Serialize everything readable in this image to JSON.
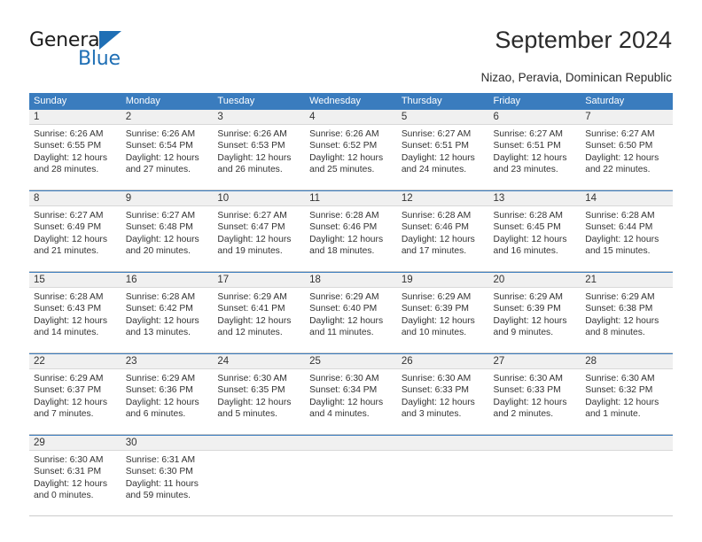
{
  "brand": {
    "name_part1": "General",
    "name_part2": "Blue",
    "triangle_icon": "triangle-logo-icon",
    "accent_color": "#1f6fb5"
  },
  "header": {
    "title": "September 2024",
    "subtitle": "Nizao, Peravia, Dominican Republic"
  },
  "calendar": {
    "header_bg": "#3a7cbe",
    "daynum_bg": "#f0f0f0",
    "weekday_headers": [
      "Sunday",
      "Monday",
      "Tuesday",
      "Wednesday",
      "Thursday",
      "Friday",
      "Saturday"
    ],
    "weeks": [
      [
        {
          "day": "1",
          "l1": "Sunrise: 6:26 AM",
          "l2": "Sunset: 6:55 PM",
          "l3": "Daylight: 12 hours",
          "l4": "and 28 minutes."
        },
        {
          "day": "2",
          "l1": "Sunrise: 6:26 AM",
          "l2": "Sunset: 6:54 PM",
          "l3": "Daylight: 12 hours",
          "l4": "and 27 minutes."
        },
        {
          "day": "3",
          "l1": "Sunrise: 6:26 AM",
          "l2": "Sunset: 6:53 PM",
          "l3": "Daylight: 12 hours",
          "l4": "and 26 minutes."
        },
        {
          "day": "4",
          "l1": "Sunrise: 6:26 AM",
          "l2": "Sunset: 6:52 PM",
          "l3": "Daylight: 12 hours",
          "l4": "and 25 minutes."
        },
        {
          "day": "5",
          "l1": "Sunrise: 6:27 AM",
          "l2": "Sunset: 6:51 PM",
          "l3": "Daylight: 12 hours",
          "l4": "and 24 minutes."
        },
        {
          "day": "6",
          "l1": "Sunrise: 6:27 AM",
          "l2": "Sunset: 6:51 PM",
          "l3": "Daylight: 12 hours",
          "l4": "and 23 minutes."
        },
        {
          "day": "7",
          "l1": "Sunrise: 6:27 AM",
          "l2": "Sunset: 6:50 PM",
          "l3": "Daylight: 12 hours",
          "l4": "and 22 minutes."
        }
      ],
      [
        {
          "day": "8",
          "l1": "Sunrise: 6:27 AM",
          "l2": "Sunset: 6:49 PM",
          "l3": "Daylight: 12 hours",
          "l4": "and 21 minutes."
        },
        {
          "day": "9",
          "l1": "Sunrise: 6:27 AM",
          "l2": "Sunset: 6:48 PM",
          "l3": "Daylight: 12 hours",
          "l4": "and 20 minutes."
        },
        {
          "day": "10",
          "l1": "Sunrise: 6:27 AM",
          "l2": "Sunset: 6:47 PM",
          "l3": "Daylight: 12 hours",
          "l4": "and 19 minutes."
        },
        {
          "day": "11",
          "l1": "Sunrise: 6:28 AM",
          "l2": "Sunset: 6:46 PM",
          "l3": "Daylight: 12 hours",
          "l4": "and 18 minutes."
        },
        {
          "day": "12",
          "l1": "Sunrise: 6:28 AM",
          "l2": "Sunset: 6:46 PM",
          "l3": "Daylight: 12 hours",
          "l4": "and 17 minutes."
        },
        {
          "day": "13",
          "l1": "Sunrise: 6:28 AM",
          "l2": "Sunset: 6:45 PM",
          "l3": "Daylight: 12 hours",
          "l4": "and 16 minutes."
        },
        {
          "day": "14",
          "l1": "Sunrise: 6:28 AM",
          "l2": "Sunset: 6:44 PM",
          "l3": "Daylight: 12 hours",
          "l4": "and 15 minutes."
        }
      ],
      [
        {
          "day": "15",
          "l1": "Sunrise: 6:28 AM",
          "l2": "Sunset: 6:43 PM",
          "l3": "Daylight: 12 hours",
          "l4": "and 14 minutes."
        },
        {
          "day": "16",
          "l1": "Sunrise: 6:28 AM",
          "l2": "Sunset: 6:42 PM",
          "l3": "Daylight: 12 hours",
          "l4": "and 13 minutes."
        },
        {
          "day": "17",
          "l1": "Sunrise: 6:29 AM",
          "l2": "Sunset: 6:41 PM",
          "l3": "Daylight: 12 hours",
          "l4": "and 12 minutes."
        },
        {
          "day": "18",
          "l1": "Sunrise: 6:29 AM",
          "l2": "Sunset: 6:40 PM",
          "l3": "Daylight: 12 hours",
          "l4": "and 11 minutes."
        },
        {
          "day": "19",
          "l1": "Sunrise: 6:29 AM",
          "l2": "Sunset: 6:39 PM",
          "l3": "Daylight: 12 hours",
          "l4": "and 10 minutes."
        },
        {
          "day": "20",
          "l1": "Sunrise: 6:29 AM",
          "l2": "Sunset: 6:39 PM",
          "l3": "Daylight: 12 hours",
          "l4": "and 9 minutes."
        },
        {
          "day": "21",
          "l1": "Sunrise: 6:29 AM",
          "l2": "Sunset: 6:38 PM",
          "l3": "Daylight: 12 hours",
          "l4": "and 8 minutes."
        }
      ],
      [
        {
          "day": "22",
          "l1": "Sunrise: 6:29 AM",
          "l2": "Sunset: 6:37 PM",
          "l3": "Daylight: 12 hours",
          "l4": "and 7 minutes."
        },
        {
          "day": "23",
          "l1": "Sunrise: 6:29 AM",
          "l2": "Sunset: 6:36 PM",
          "l3": "Daylight: 12 hours",
          "l4": "and 6 minutes."
        },
        {
          "day": "24",
          "l1": "Sunrise: 6:30 AM",
          "l2": "Sunset: 6:35 PM",
          "l3": "Daylight: 12 hours",
          "l4": "and 5 minutes."
        },
        {
          "day": "25",
          "l1": "Sunrise: 6:30 AM",
          "l2": "Sunset: 6:34 PM",
          "l3": "Daylight: 12 hours",
          "l4": "and 4 minutes."
        },
        {
          "day": "26",
          "l1": "Sunrise: 6:30 AM",
          "l2": "Sunset: 6:33 PM",
          "l3": "Daylight: 12 hours",
          "l4": "and 3 minutes."
        },
        {
          "day": "27",
          "l1": "Sunrise: 6:30 AM",
          "l2": "Sunset: 6:33 PM",
          "l3": "Daylight: 12 hours",
          "l4": "and 2 minutes."
        },
        {
          "day": "28",
          "l1": "Sunrise: 6:30 AM",
          "l2": "Sunset: 6:32 PM",
          "l3": "Daylight: 12 hours",
          "l4": "and 1 minute."
        }
      ],
      [
        {
          "day": "29",
          "l1": "Sunrise: 6:30 AM",
          "l2": "Sunset: 6:31 PM",
          "l3": "Daylight: 12 hours",
          "l4": "and 0 minutes."
        },
        {
          "day": "30",
          "l1": "Sunrise: 6:31 AM",
          "l2": "Sunset: 6:30 PM",
          "l3": "Daylight: 11 hours",
          "l4": "and 59 minutes."
        },
        {
          "day": "",
          "l1": "",
          "l2": "",
          "l3": "",
          "l4": ""
        },
        {
          "day": "",
          "l1": "",
          "l2": "",
          "l3": "",
          "l4": ""
        },
        {
          "day": "",
          "l1": "",
          "l2": "",
          "l3": "",
          "l4": ""
        },
        {
          "day": "",
          "l1": "",
          "l2": "",
          "l3": "",
          "l4": ""
        },
        {
          "day": "",
          "l1": "",
          "l2": "",
          "l3": "",
          "l4": ""
        }
      ]
    ]
  }
}
